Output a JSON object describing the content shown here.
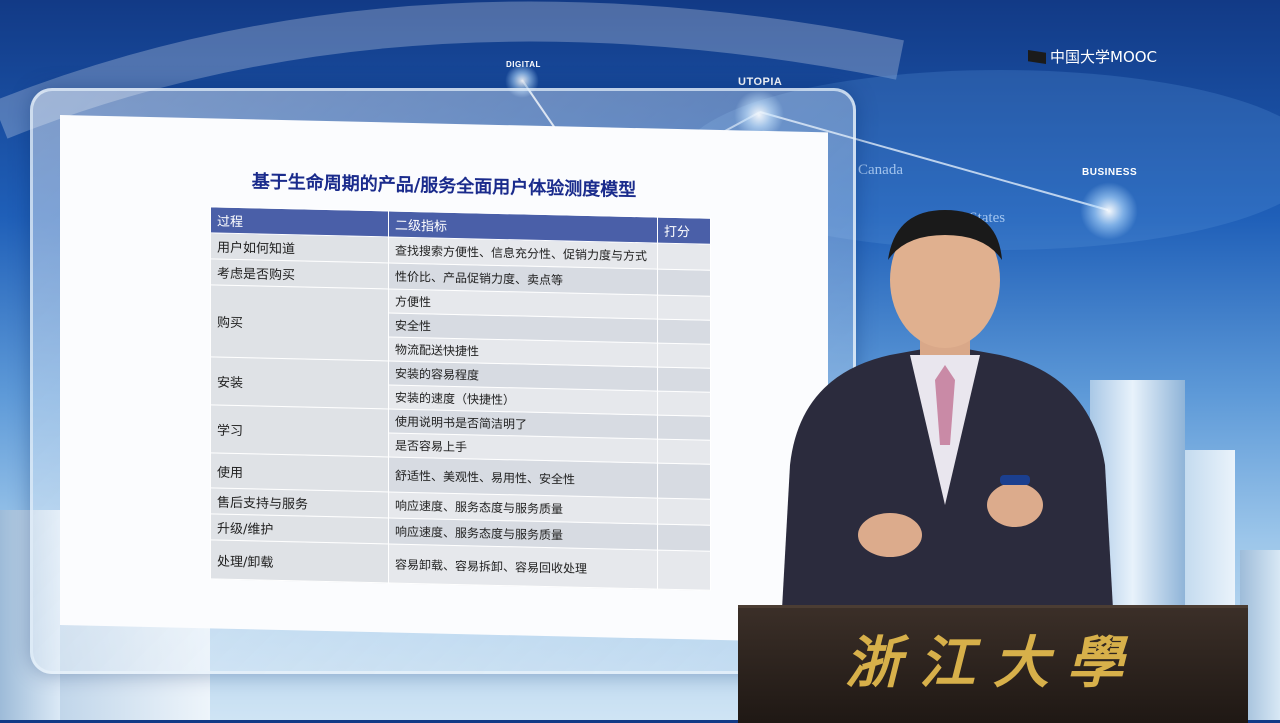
{
  "watermark": {
    "logo_text": "中国大学MOOC"
  },
  "background_labels": {
    "digital": "DIGITAL",
    "utopia": "UTOPIA",
    "business": "BUSINESS",
    "canada": "Canada",
    "states": "d  States"
  },
  "slide": {
    "title": "基于生命周期的产品/服务全面用户体验测度模型",
    "headers": {
      "process": "过程",
      "indicator": "二级指标",
      "score": "打分"
    },
    "rows": [
      {
        "process": "用户如何知道",
        "indicators": [
          "查找搜索方便性、信息充分性、促销力度与方式"
        ]
      },
      {
        "process": "考虑是否购买",
        "indicators": [
          "性价比、产品促销力度、卖点等"
        ]
      },
      {
        "process": "购买",
        "indicators": [
          "方便性",
          "安全性",
          "物流配送快捷性"
        ]
      },
      {
        "process": "安装",
        "indicators": [
          "安装的容易程度",
          "安装的速度（快捷性）"
        ]
      },
      {
        "process": "学习",
        "indicators": [
          "使用说明书是否简洁明了",
          "是否容易上手"
        ]
      },
      {
        "process": "使用",
        "indicators": [
          "舒适性、美观性、易用性、安全性"
        ]
      },
      {
        "process": "售后支持与服务",
        "indicators": [
          "响应速度、服务态度与服务质量"
        ]
      },
      {
        "process": "升级/维护",
        "indicators": [
          "响应速度、服务态度与服务质量"
        ]
      },
      {
        "process": "处理/卸载",
        "indicators": [
          "容易卸载、容易拆卸、容易回收处理"
        ]
      }
    ]
  },
  "podium": {
    "text": "浙江大學"
  },
  "colors": {
    "header_bg": "#4a5fa8",
    "title": "#1a2b8c",
    "podium_text": "#d7b04a"
  }
}
